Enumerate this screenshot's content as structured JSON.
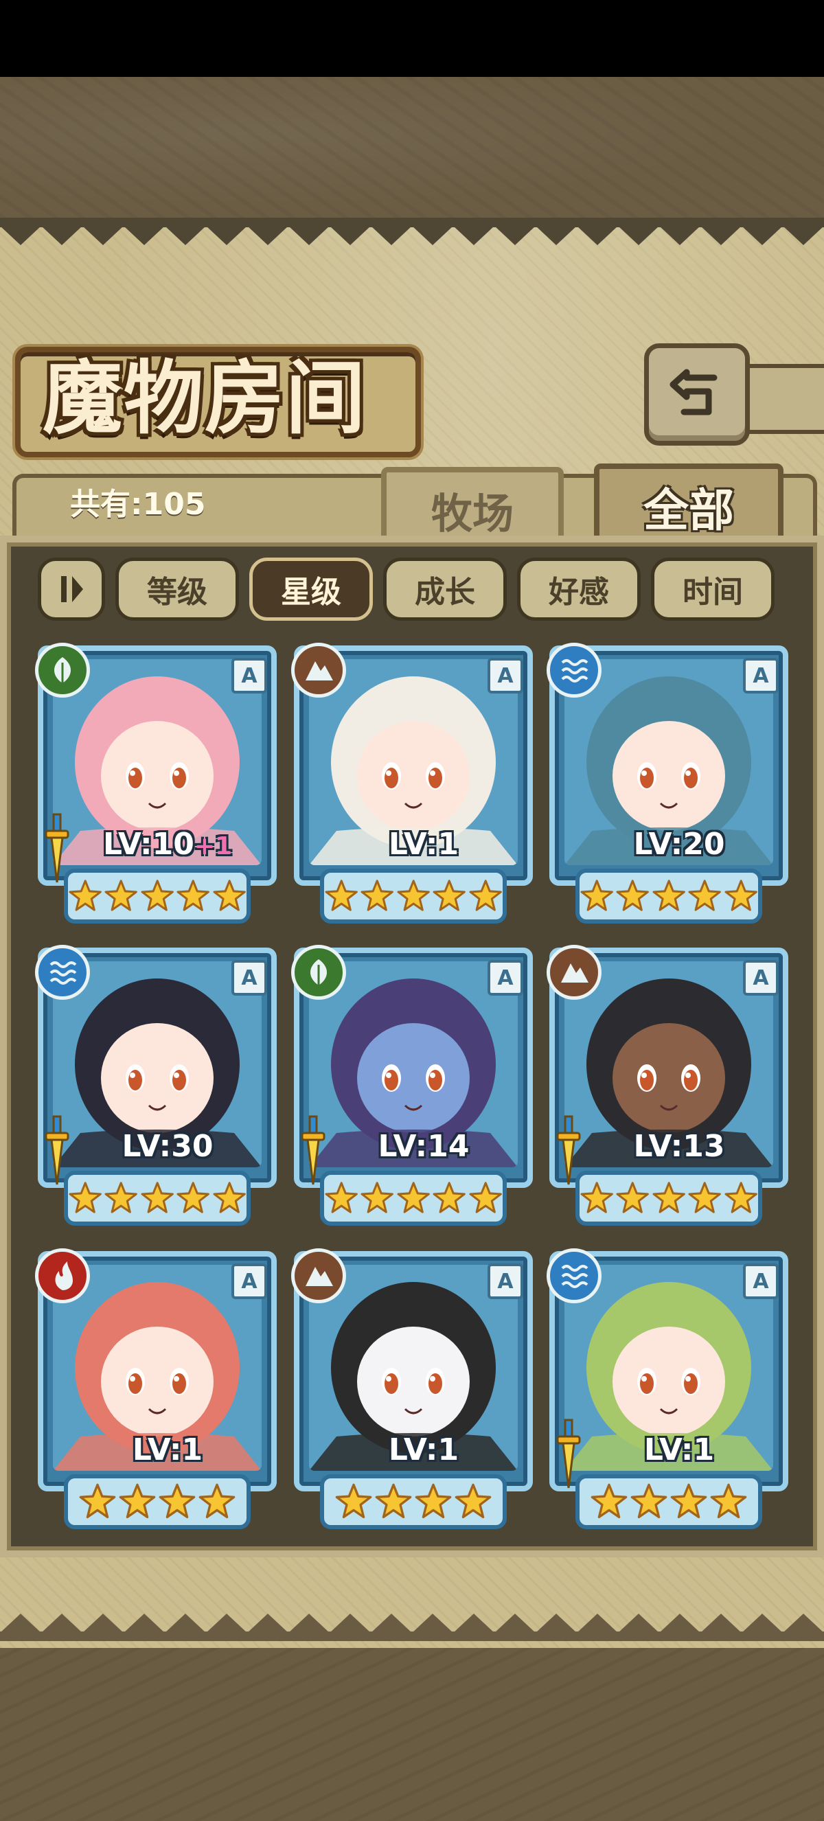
{
  "header": {
    "title": "魔物房间"
  },
  "tabs": {
    "count_label": "共有:105",
    "ranch": "牧场",
    "all": "全部"
  },
  "sort": {
    "buttons": [
      {
        "label": "等级",
        "active": false
      },
      {
        "label": "星级",
        "active": true
      },
      {
        "label": "成长",
        "active": false
      },
      {
        "label": "好感",
        "active": false
      },
      {
        "label": "时间",
        "active": false
      }
    ]
  },
  "elements": {
    "leaf": "#3b7a2e",
    "earth": "#7a4a2e",
    "water": "#2f7ec2",
    "fire": "#b3261e"
  },
  "cards": [
    {
      "element": "leaf",
      "level": "LV:10",
      "plus": "+1",
      "rank": "A",
      "stars": 5,
      "sword": true,
      "hair": "#f2a9b8",
      "skin": "#fde7dc",
      "bg": "#5aa0c4"
    },
    {
      "element": "earth",
      "level": "LV:1",
      "plus": "",
      "rank": "A",
      "stars": 5,
      "sword": false,
      "hair": "#f1ede4",
      "skin": "#fde7dc",
      "bg": "#5aa0c4"
    },
    {
      "element": "water",
      "level": "LV:20",
      "plus": "",
      "rank": "A",
      "stars": 5,
      "sword": false,
      "hair": "#4f8aa0",
      "skin": "#fde7dc",
      "bg": "#5aa0c4"
    },
    {
      "element": "water",
      "level": "LV:30",
      "plus": "",
      "rank": "A",
      "stars": 5,
      "sword": true,
      "hair": "#2a2a38",
      "skin": "#fde7dc",
      "bg": "#5aa0c4"
    },
    {
      "element": "leaf",
      "level": "LV:14",
      "plus": "",
      "rank": "A",
      "stars": 5,
      "sword": true,
      "hair": "#4a3f77",
      "skin": "#7fa0d8",
      "bg": "#5aa0c4"
    },
    {
      "element": "earth",
      "level": "LV:13",
      "plus": "",
      "rank": "A",
      "stars": 5,
      "sword": true,
      "hair": "#2c2b30",
      "skin": "#8a6048",
      "bg": "#5aa0c4"
    },
    {
      "element": "fire",
      "level": "LV:1",
      "plus": "",
      "rank": "A",
      "stars": 4,
      "sword": false,
      "hair": "#e37a6c",
      "skin": "#fde7dc",
      "bg": "#5aa0c4"
    },
    {
      "element": "earth",
      "level": "LV:1",
      "plus": "",
      "rank": "A",
      "stars": 4,
      "sword": false,
      "hair": "#2b2b2b",
      "skin": "#f4f4f6",
      "bg": "#5aa0c4"
    },
    {
      "element": "water",
      "level": "LV:1",
      "plus": "",
      "rank": "A",
      "stars": 4,
      "sword": true,
      "hair": "#a6c86a",
      "skin": "#fde7dc",
      "bg": "#5aa0c4"
    }
  ]
}
